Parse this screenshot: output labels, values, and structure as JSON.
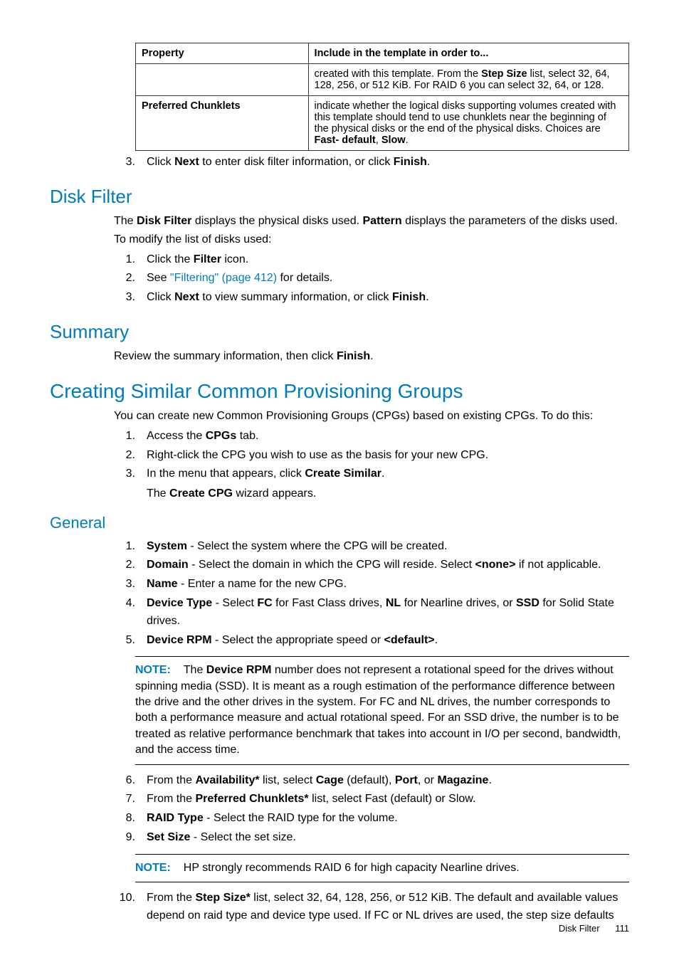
{
  "table": {
    "headers": [
      "Property",
      "Include in the template in order to..."
    ],
    "rows": [
      {
        "property": "",
        "desc_pre": "created with this template. From the ",
        "b1": "Step Size",
        "desc_post": " list, select 32, 64, 128, 256, or 512 KiB. For RAID 6 you can select 32, 64, or 128."
      },
      {
        "property": "Preferred Chunklets",
        "desc_pre": "indicate whether the logical disks supporting volumes created with this template should tend to use chunklets near the beginning of the physical disks or the end of the physical disks. Choices are ",
        "b1": "Fast- default",
        "mid": ", ",
        "b2": "Slow",
        "desc_post": "."
      }
    ]
  },
  "step3_top": {
    "num": "3.",
    "pre": "Click ",
    "b1": "Next",
    "mid": " to enter disk filter information, or click ",
    "b2": "Finish",
    "post": "."
  },
  "disk_filter": {
    "heading": "Disk Filter",
    "intro_pre": "The ",
    "b1": "Disk Filter",
    "intro_mid": " displays the physical disks used. ",
    "b2": "Pattern",
    "intro_post": " displays the parameters of the disks used.",
    "modify_intro": "To modify the list of disks used:",
    "steps": [
      {
        "n": "1.",
        "pre": "Click the ",
        "b": "Filter",
        "post": " icon."
      },
      {
        "n": "2.",
        "pre": "See ",
        "link": "\"Filtering\" (page 412)",
        "post": " for details."
      },
      {
        "n": "3.",
        "pre": "Click ",
        "b": "Next",
        "mid": " to view summary information, or click ",
        "b2": "Finish",
        "post": "."
      }
    ]
  },
  "summary": {
    "heading": "Summary",
    "text_pre": "Review the summary information, then click ",
    "b": "Finish",
    "text_post": "."
  },
  "creating": {
    "heading": "Creating Similar Common Provisioning Groups",
    "intro": "You can create new Common Provisioning Groups (CPGs) based on existing CPGs. To do this:",
    "steps": [
      {
        "n": "1.",
        "pre": "Access the ",
        "b": "CPGs",
        "post": " tab."
      },
      {
        "n": "2.",
        "pre": "Right-click the CPG you wish to use as the basis for your new CPG.",
        "b": "",
        "post": ""
      },
      {
        "n": "3.",
        "pre": "In the menu that appears, click ",
        "b": "Create Similar",
        "post": "."
      }
    ],
    "after_step3_pre": "The ",
    "after_step3_b": "Create CPG",
    "after_step3_post": " wizard appears."
  },
  "general": {
    "heading": "General",
    "pre_steps": [
      {
        "n": "1.",
        "b": "System",
        "post": " - Select the system where the CPG will be created."
      },
      {
        "n": "2.",
        "b": "Domain",
        "post": " - Select the domain in which the CPG will reside. Select ",
        "b2": "<none>",
        "post2": " if not applicable."
      },
      {
        "n": "3.",
        "b": "Name",
        "post": " - Enter a name for the new CPG."
      },
      {
        "n": "4.",
        "b": "Device Type",
        "post": " - Select ",
        "b2": "FC",
        "mid2": " for Fast Class drives, ",
        "b3": "NL",
        "mid3": " for Nearline drives, or ",
        "b4": "SSD",
        "post2": " for Solid State drives."
      },
      {
        "n": "5.",
        "b": "Device RPM",
        "post": " - Select the appropriate speed or ",
        "b2": "<default>",
        "post2": "."
      }
    ],
    "note1_label": "NOTE:",
    "note1_pre": "The ",
    "note1_b": "Device RPM",
    "note1_post": " number does not represent a rotational speed for the drives without spinning media (SSD). It is meant as a rough estimation of the performance difference between the drive and the other drives in the system. For FC and NL drives, the number corresponds to both a performance measure and actual rotational speed. For an SSD drive, the number is to be treated as relative performance benchmark that takes into account in I/O per second, bandwidth, and the access time.",
    "post_steps": [
      {
        "n": "6.",
        "pre": "From the ",
        "b": "Availability*",
        "mid": " list, select ",
        "b2": "Cage",
        "mid2": " (default), ",
        "b3": "Port",
        "mid3": ", or ",
        "b4": "Magazine",
        "post": "."
      },
      {
        "n": "7.",
        "pre": "From the ",
        "b": "Preferred Chunklets*",
        "post": " list, select Fast (default) or Slow."
      },
      {
        "n": "8.",
        "b": "RAID Type",
        "post": " - Select the RAID type for the volume."
      },
      {
        "n": "9.",
        "b": "Set Size",
        "post": " - Select the set size."
      }
    ],
    "note2_label": "NOTE:",
    "note2_text": "HP strongly recommends RAID 6 for high capacity Nearline drives.",
    "step10": {
      "n": "10.",
      "pre": "From the ",
      "b": "Step Size*",
      "post": " list, select 32, 64, 128, 256, or 512 KiB. The default and available values depend on raid type and device type used. If FC or NL drives are used, the step size defaults"
    }
  },
  "footer": {
    "section": "Disk Filter",
    "page": "111"
  }
}
